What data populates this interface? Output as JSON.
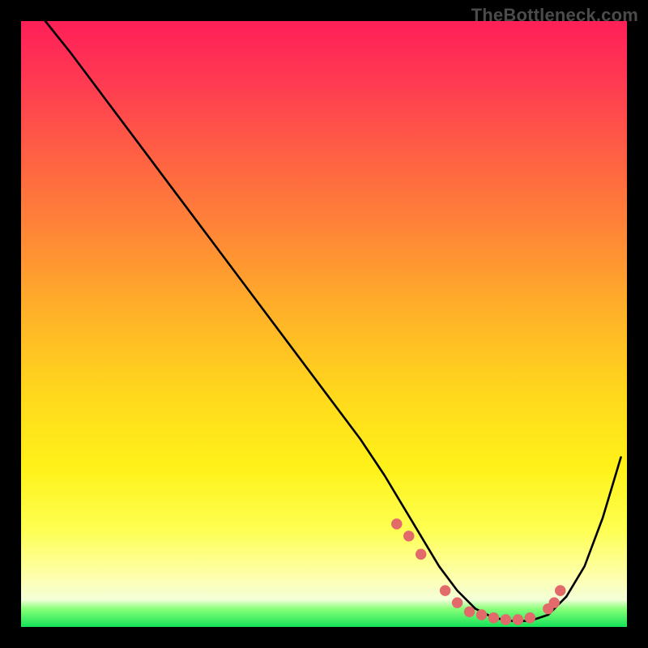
{
  "watermark": "TheBottleneck.com",
  "chart_data": {
    "type": "line",
    "title": "",
    "xlabel": "",
    "ylabel": "",
    "xlim": [
      0,
      100
    ],
    "ylim": [
      0,
      100
    ],
    "series": [
      {
        "name": "curve",
        "color": "#000000",
        "stroke_width": 2,
        "x": [
          4,
          8,
          14,
          20,
          26,
          32,
          38,
          44,
          50,
          56,
          60,
          63,
          66,
          69,
          72,
          75,
          78,
          81,
          84,
          87,
          90,
          93,
          96,
          99
        ],
        "y": [
          100,
          95,
          87,
          79,
          71,
          63,
          55,
          47,
          39,
          31,
          25,
          20,
          15,
          10,
          6,
          3,
          1.5,
          1,
          1,
          2,
          5,
          10,
          18,
          28
        ]
      },
      {
        "name": "markers",
        "color": "#e26a6a",
        "type": "scatter",
        "x": [
          62,
          64,
          66,
          70,
          72,
          74,
          76,
          78,
          80,
          82,
          84,
          87,
          88,
          89
        ],
        "y": [
          17,
          15,
          12,
          6,
          4,
          2.5,
          2,
          1.5,
          1.2,
          1.2,
          1.5,
          3,
          4,
          6
        ]
      }
    ],
    "gradient_stops": [
      {
        "pos": 0,
        "color": "#ff1f58"
      },
      {
        "pos": 0.35,
        "color": "#ff8736"
      },
      {
        "pos": 0.62,
        "color": "#ffd91c"
      },
      {
        "pos": 0.92,
        "color": "#fdffb0"
      },
      {
        "pos": 1.0,
        "color": "#14e357"
      }
    ]
  }
}
